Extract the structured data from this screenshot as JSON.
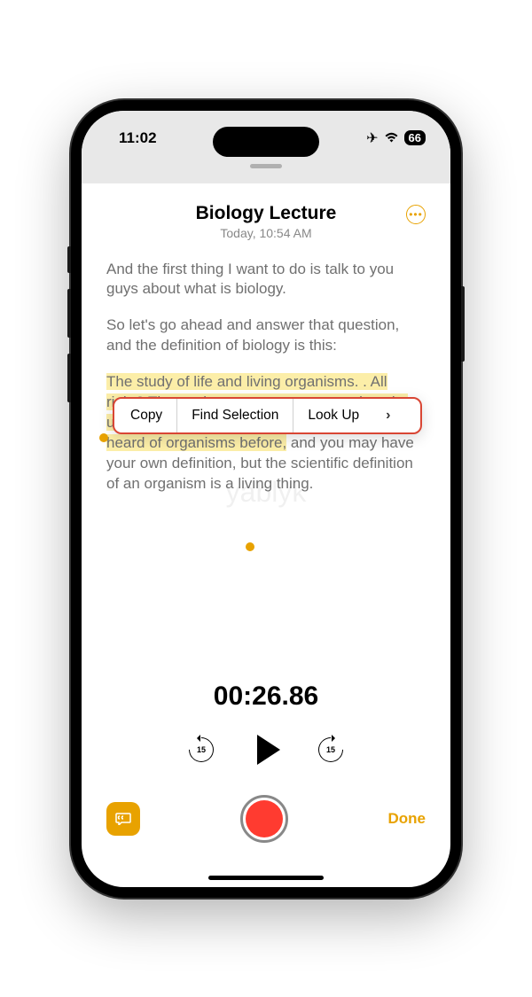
{
  "status": {
    "time": "11:02",
    "battery": "66"
  },
  "note": {
    "title": "Biology Lecture",
    "subtitle": "Today, 10:54 AM"
  },
  "transcript": {
    "p1": "And the first thing I want to do is talk to you guys about what is biology.",
    "p2": "So let's go ahead and answer that question, and the definition of biology is this:",
    "p3_highlighted": "The study of life and living organisms. . All right? That makes sense up to a certain point up until organisms, because you may have heard of organisms before,",
    "p3_rest": " and you may have your own definition, but the scientific definition of an organism is a living thing."
  },
  "context_menu": {
    "copy": "Copy",
    "find": "Find Selection",
    "lookup": "Look Up"
  },
  "player": {
    "time": "00:26.86",
    "skip_amount": "15"
  },
  "actions": {
    "done": "Done"
  },
  "watermark": "yablyk"
}
